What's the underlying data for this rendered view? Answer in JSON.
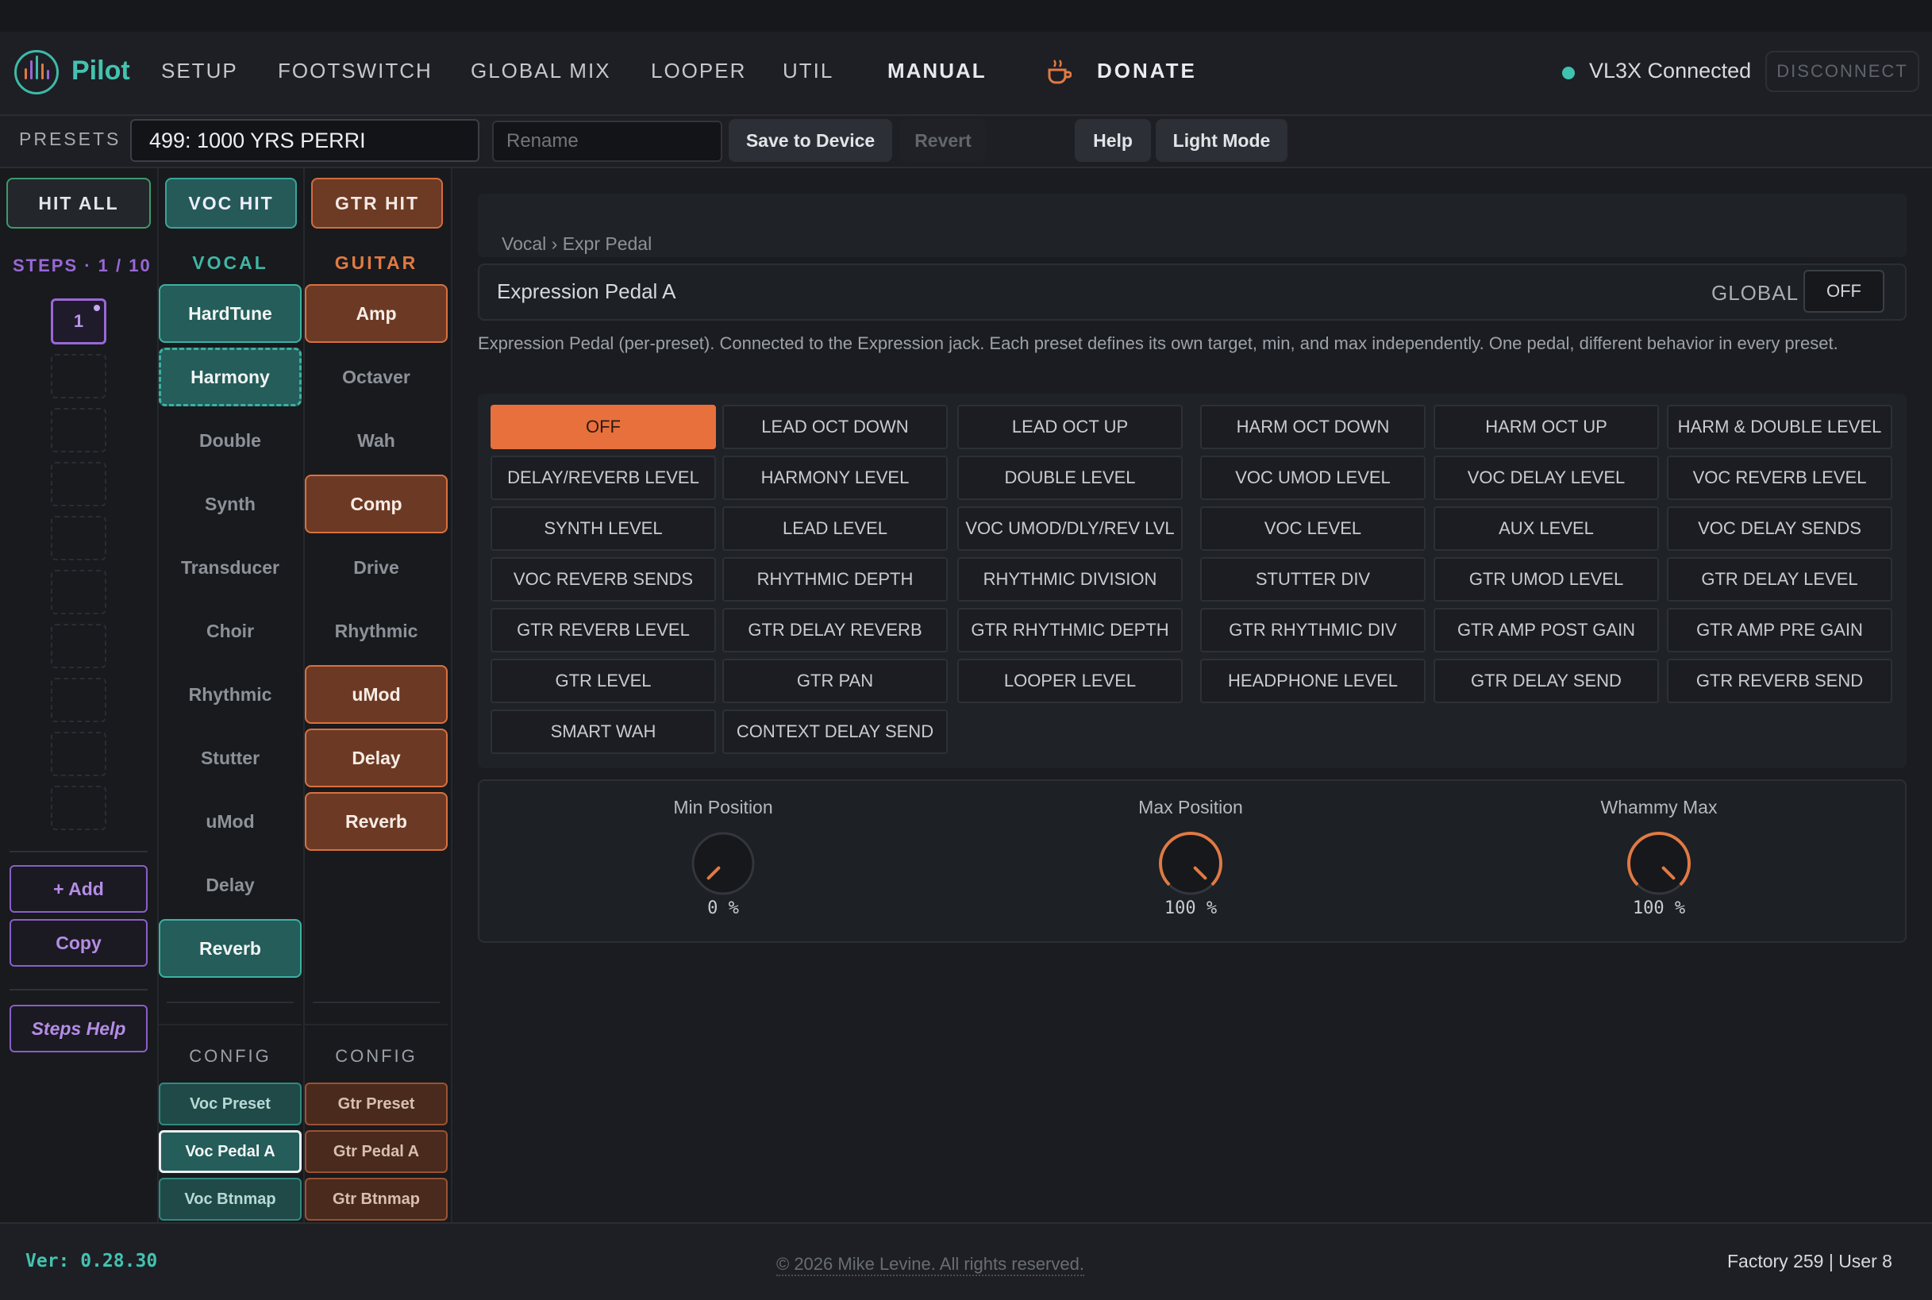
{
  "app": {
    "name": "Pilot"
  },
  "nav": {
    "items": [
      "SETUP",
      "FOOTSWITCH",
      "GLOBAL MIX",
      "LOOPER",
      "UTIL",
      "MANUAL"
    ],
    "donate": "DONATE"
  },
  "status": {
    "connected": "VL3X Connected",
    "disconnect": "DISCONNECT",
    "dot_color": "#3fc2b0"
  },
  "presets": {
    "label": "PRESETS",
    "current": "499: 1000 YRS PERRI",
    "rename_placeholder": "Rename",
    "save": "Save to Device",
    "revert": "Revert",
    "help": "Help",
    "light_mode": "Light Mode"
  },
  "hit": {
    "all": "HIT ALL",
    "voc": "VOC HIT",
    "gtr": "GTR HIT"
  },
  "steps": {
    "label": "STEPS · 1 / 10",
    "current": "1",
    "add": "+ Add",
    "copy": "Copy",
    "help": "Steps Help"
  },
  "vocal": {
    "title": "VOCAL",
    "blocks": [
      {
        "name": "HardTune",
        "state": "on"
      },
      {
        "name": "Harmony",
        "state": "selected"
      },
      {
        "name": "Double",
        "state": "off"
      },
      {
        "name": "Synth",
        "state": "off"
      },
      {
        "name": "Transducer",
        "state": "off"
      },
      {
        "name": "Choir",
        "state": "off"
      },
      {
        "name": "Rhythmic",
        "state": "off"
      },
      {
        "name": "Stutter",
        "state": "off"
      },
      {
        "name": "uMod",
        "state": "off"
      },
      {
        "name": "Delay",
        "state": "off"
      },
      {
        "name": "Reverb",
        "state": "on"
      }
    ],
    "config_title": "CONFIG",
    "config": [
      "Voc Preset",
      "Voc Pedal A",
      "Voc Btnmap"
    ]
  },
  "guitar": {
    "title": "GUITAR",
    "blocks": [
      {
        "name": "Amp",
        "state": "on"
      },
      {
        "name": "Octaver",
        "state": "off"
      },
      {
        "name": "Wah",
        "state": "off"
      },
      {
        "name": "Comp",
        "state": "on"
      },
      {
        "name": "Drive",
        "state": "off"
      },
      {
        "name": "Rhythmic",
        "state": "off"
      },
      {
        "name": "uMod",
        "state": "on"
      },
      {
        "name": "Delay",
        "state": "on"
      },
      {
        "name": "Reverb",
        "state": "on"
      }
    ],
    "config_title": "CONFIG",
    "config": [
      "Gtr Preset",
      "Gtr Pedal A",
      "Gtr Btnmap"
    ]
  },
  "main": {
    "breadcrumb": "Vocal › Expr Pedal",
    "title": "Expression Pedal A",
    "global_label": "GLOBAL",
    "global_toggle": "OFF",
    "description": "Expression Pedal (per-preset). Connected to the Expression jack. Each preset defines its own target, min, and max independently. One pedal, different behavior in every preset.",
    "selected_target": "OFF",
    "targets": [
      "OFF",
      "LEAD OCT DOWN",
      "LEAD OCT UP",
      "HARM OCT DOWN",
      "HARM OCT UP",
      "HARM & DOUBLE LEVEL",
      "DELAY/REVERB LEVEL",
      "HARMONY LEVEL",
      "DOUBLE LEVEL",
      "VOC UMOD LEVEL",
      "VOC DELAY LEVEL",
      "VOC REVERB LEVEL",
      "SYNTH LEVEL",
      "LEAD LEVEL",
      "VOC UMOD/DLY/REV LVL",
      "VOC LEVEL",
      "AUX LEVEL",
      "VOC DELAY SENDS",
      "VOC REVERB SENDS",
      "RHYTHMIC DEPTH",
      "RHYTHMIC DIVISION",
      "STUTTER DIV",
      "GTR UMOD LEVEL",
      "GTR DELAY LEVEL",
      "GTR REVERB LEVEL",
      "GTR DELAY REVERB",
      "GTR RHYTHMIC DEPTH",
      "GTR RHYTHMIC DIV",
      "GTR AMP POST GAIN",
      "GTR AMP PRE GAIN",
      "GTR LEVEL",
      "GTR PAN",
      "LOOPER LEVEL",
      "HEADPHONE LEVEL",
      "GTR DELAY SEND",
      "GTR REVERB SEND",
      "SMART WAH",
      "CONTEXT DELAY SEND"
    ],
    "knobs": [
      {
        "label": "Min Position",
        "value": 0,
        "display": "0 %"
      },
      {
        "label": "Max Position",
        "value": 100,
        "display": "100 %"
      },
      {
        "label": "Whammy Max",
        "value": 100,
        "display": "100 %"
      }
    ]
  },
  "footer": {
    "version": "Ver: 0.28.30",
    "copyright": "© 2026 Mike Levine. All rights reserved.",
    "counts": "Factory 259 | User 8"
  },
  "colors": {
    "accent_teal": "#3fb6a4",
    "accent_orange": "#e8703c",
    "accent_purple": "#9a67d6"
  }
}
